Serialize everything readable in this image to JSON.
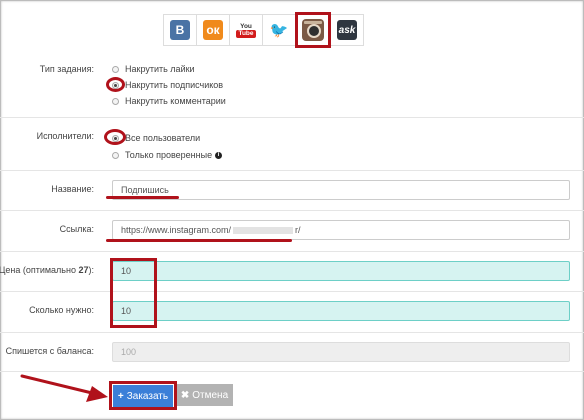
{
  "networks": [
    {
      "name": "vk",
      "label": "B"
    },
    {
      "name": "odnoklassniki",
      "label": "ок"
    },
    {
      "name": "youtube",
      "label_top": "You",
      "label_bottom": "Tube"
    },
    {
      "name": "twitter",
      "label": "🐦"
    },
    {
      "name": "instagram",
      "label": ""
    },
    {
      "name": "ask",
      "label": "ask"
    }
  ],
  "task_type": {
    "label": "Тип задания:",
    "options": [
      "Накрутить лайки",
      "Накрутить подписчиков",
      "Накрутить комментарии"
    ],
    "selected": 1
  },
  "performers": {
    "label": "Исполнители:",
    "options": [
      "Все пользователи",
      "Только проверенные"
    ],
    "selected": 0
  },
  "name_field": {
    "label": "Название:",
    "value": "Подпишись"
  },
  "link_field": {
    "label": "Ссылка:",
    "value_start": "https://www.instagram.com/",
    "value_end": "r/"
  },
  "price_field": {
    "label": "Цена (оптимально ",
    "label_bold": "27",
    "label_end": "):",
    "value": "10"
  },
  "count_field": {
    "label": "Сколько нужно:",
    "value": "10"
  },
  "balance_field": {
    "label": "Спишется с баланса:",
    "value": "100"
  },
  "actions": {
    "submit": "Заказать",
    "cancel": "Отмена"
  },
  "colors": {
    "annotation": "#b0121b",
    "primary": "#3b7fd8",
    "highlight": "#d6f3f1"
  }
}
